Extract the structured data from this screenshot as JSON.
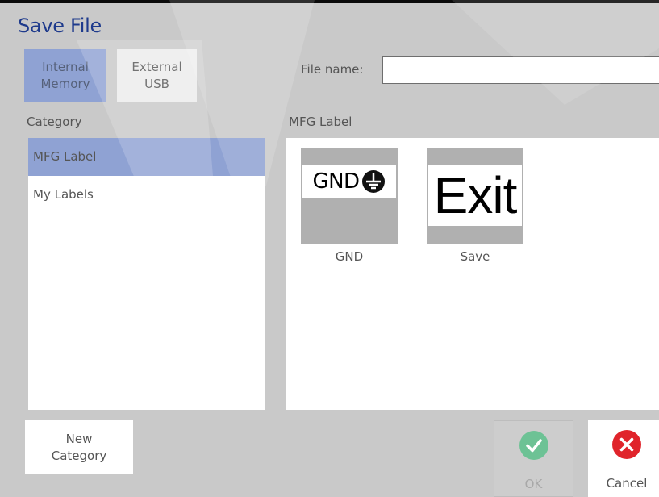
{
  "dialog": {
    "title": "Save File"
  },
  "memory": {
    "internal_label": "Internal\nMemory",
    "external_label": "External\nUSB"
  },
  "file_name": {
    "label": "File name:",
    "value": ""
  },
  "category": {
    "header": "Category",
    "items": [
      {
        "label": "MFG Label",
        "selected": true
      },
      {
        "label": "My Labels",
        "selected": false
      }
    ]
  },
  "files": {
    "header": "MFG Label",
    "items": [
      {
        "name": "GND",
        "preview_text": "GND",
        "icon": "ground-symbol-icon"
      },
      {
        "name": "Save",
        "preview_text": "Exit",
        "icon": ""
      }
    ]
  },
  "buttons": {
    "new_category": "New\nCategory",
    "ok": "OK",
    "cancel": "Cancel"
  },
  "colors": {
    "title": "#1e3a8c",
    "selected": "#8fa2d3",
    "ok_icon": "#4cbd82",
    "cancel_icon": "#e0242b"
  }
}
